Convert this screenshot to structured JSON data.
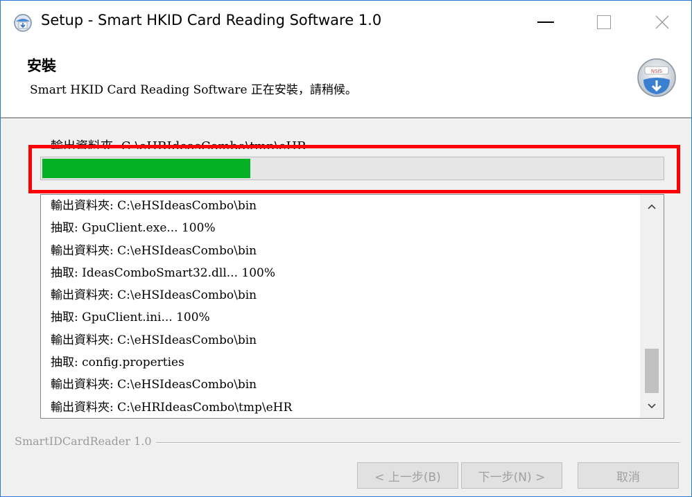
{
  "window": {
    "title": "Setup - Smart HKID Card Reading Software 1.0",
    "controls": {
      "minimize_icon": "minimize-icon",
      "maximize_icon": "maximize-icon",
      "close_icon": "close-icon"
    }
  },
  "header": {
    "title": "安裝",
    "subtitle": "Smart HKID Card Reading Software 正在安裝，請稍候。",
    "logo_text": "NSIS"
  },
  "status": {
    "text": "輸出資料夾: C:\\eHRIdeasCombo\\tmp\\eHR"
  },
  "progress": {
    "fraction": 0.335,
    "color": "#06b025"
  },
  "log": {
    "items": [
      "輸出資料夾: C:\\eHSIdeasCombo\\bin",
      "抽取: GpuClient.exe... 100%",
      "輸出資料夾: C:\\eHSIdeasCombo\\bin",
      "抽取: IdeasComboSmart32.dll... 100%",
      "輸出資料夾: C:\\eHSIdeasCombo\\bin",
      "抽取: GpuClient.ini... 100%",
      "輸出資料夾: C:\\eHSIdeasCombo\\bin",
      "抽取: config.properties",
      "輸出資料夾: C:\\eHSIdeasCombo\\bin",
      "輸出資料夾: C:\\eHRIdeasCombo\\tmp\\eHR"
    ],
    "scroll_up": "^",
    "scroll_down": "⌄"
  },
  "footer": {
    "brand": "SmartIDCardReader 1.0",
    "back_label": "< 上一步(B)",
    "next_label": "下一步(N) >",
    "cancel_label": "取消"
  },
  "colors": {
    "highlight": "#ff0000",
    "titlebar_border": "#2b79d6"
  }
}
